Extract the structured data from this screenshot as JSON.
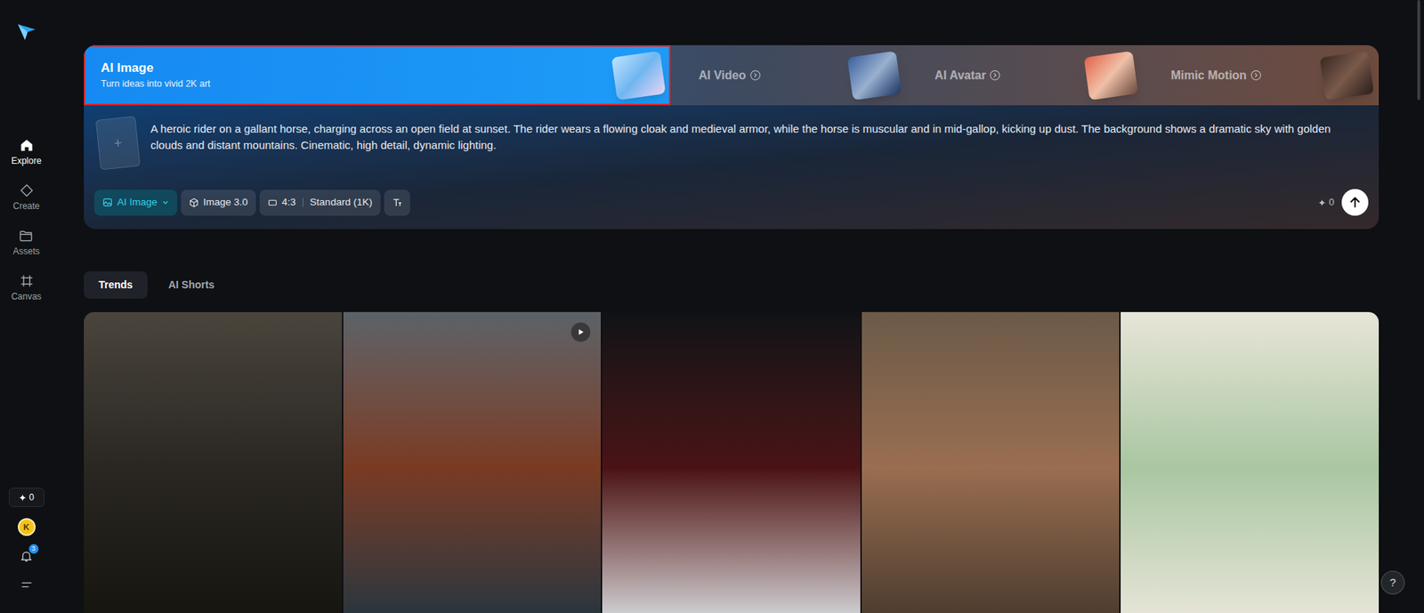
{
  "sidebar": {
    "items": [
      {
        "label": "Explore",
        "selected": true
      },
      {
        "label": "Create",
        "selected": false
      },
      {
        "label": "Assets",
        "selected": false
      },
      {
        "label": "Canvas",
        "selected": false
      }
    ],
    "credits": "0",
    "avatar": "K",
    "notifications": "3"
  },
  "features": [
    {
      "title": "AI Image",
      "subtitle": "Turn ideas into vivid 2K art",
      "selected": true,
      "highlighted": true
    },
    {
      "title": "AI Video",
      "selected": false,
      "highlighted": false
    },
    {
      "title": "AI Avatar",
      "selected": false,
      "highlighted": false
    },
    {
      "title": "Mimic Motion",
      "selected": false,
      "highlighted": false
    }
  ],
  "prompt": {
    "text": "A heroic rider on a gallant horse, charging across an open field at sunset. The rider wears a flowing cloak and medieval armor, while the horse is muscular and in mid-gallop, kicking up dust. The background shows a dramatic sky with golden clouds and distant mountains. Cinematic, high detail, dynamic lighting."
  },
  "toolbar": {
    "mode": "AI Image",
    "model": "Image 3.0",
    "ratio": "4:3",
    "quality": "Standard (1K)",
    "credits": "0"
  },
  "content_tabs": [
    {
      "label": "Trends",
      "selected": true
    },
    {
      "label": "AI Shorts",
      "selected": false
    }
  ],
  "gallery": [
    {
      "kind": "image"
    },
    {
      "kind": "video"
    },
    {
      "kind": "image"
    },
    {
      "kind": "image"
    },
    {
      "kind": "image"
    }
  ],
  "help": "?"
}
